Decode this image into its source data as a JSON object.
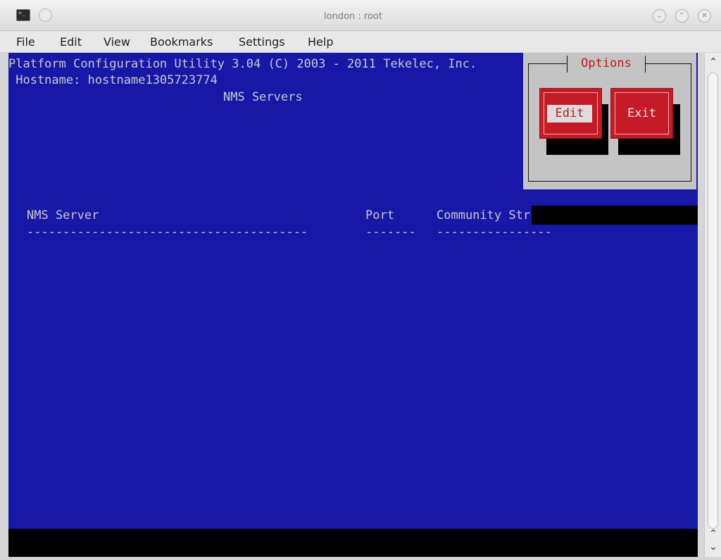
{
  "window": {
    "title": "london : root",
    "controls": {
      "minimize": "⌄",
      "maximize": "⌃",
      "close": "✕"
    }
  },
  "menubar": [
    "File",
    "Edit",
    "View",
    "Bookmarks",
    "Settings",
    "Help"
  ],
  "terminal": {
    "header_line": "Platform Configuration Utility 3.04 (C) 2003 - 2011 Tekelec, Inc.",
    "hostname_line": " Hostname: hostname1305723774",
    "screen_title": "NMS Servers",
    "table": {
      "columns": [
        "NMS Server",
        "Port",
        "Community String"
      ],
      "separators": [
        "---------------------------------------",
        "-------",
        "----------------"
      ],
      "rows": []
    },
    "options_dialog": {
      "title": "Options",
      "buttons": [
        "Edit",
        "Exit"
      ],
      "selected": "Edit"
    }
  },
  "colors": {
    "terminal_background": "#1818a8",
    "dialog_background": "#c4c4c4",
    "button_red": "#c61b26",
    "title_red": "#c21a1a"
  },
  "icons": [
    "terminal-app-icon",
    "pin-icon",
    "minimize-icon",
    "maximize-icon",
    "close-icon",
    "scroll-up-icon",
    "scroll-down-icon"
  ]
}
